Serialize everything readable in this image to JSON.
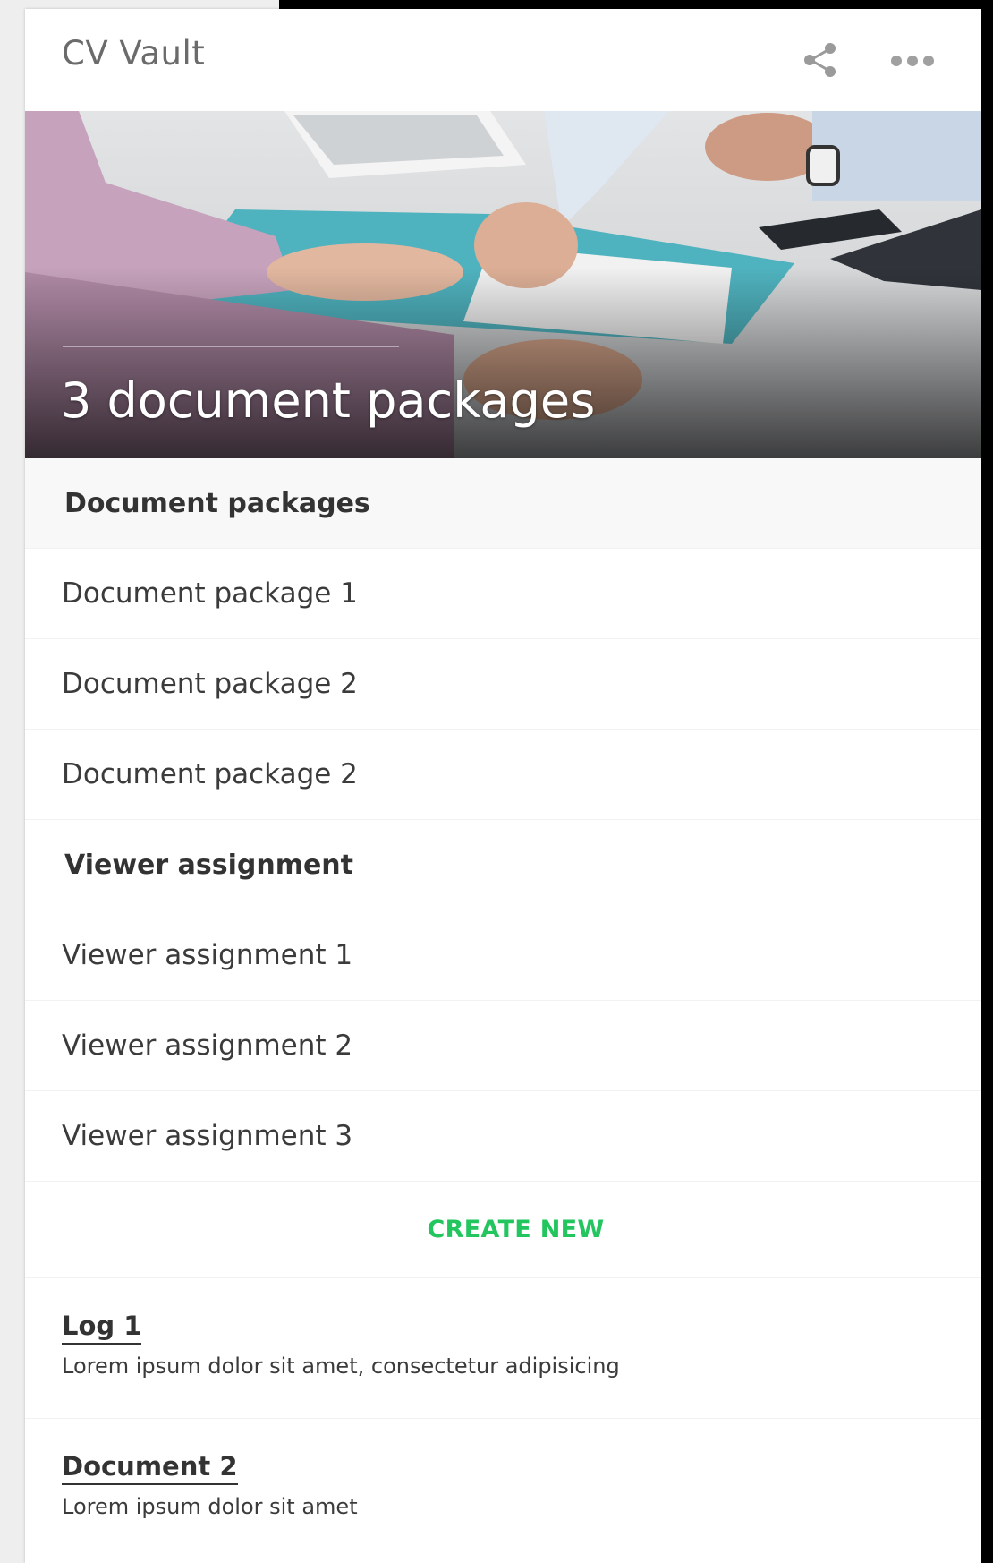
{
  "app": {
    "title": "CV Vault",
    "share_icon": "share-icon",
    "more_icon": "more-horizontal-icon"
  },
  "hero": {
    "title": "3 document packages"
  },
  "document_packages": {
    "header": "Document packages",
    "items": [
      "Document package 1",
      "Document package 2",
      "Document package 2"
    ]
  },
  "viewer_assignments": {
    "header": "Viewer assignment",
    "items": [
      "Viewer assignment 1",
      "Viewer assignment 2",
      "Viewer assignment 3"
    ]
  },
  "actions": {
    "create_new": "CREATE NEW"
  },
  "logs": [
    {
      "title": "Log 1",
      "description": "Lorem ipsum dolor sit amet, consectetur adipisicing"
    },
    {
      "title": "Document 2",
      "description": "Lorem ipsum dolor sit amet"
    }
  ],
  "colors": {
    "accent": "#22c55e",
    "text": "#3b3b3b",
    "app_title": "#6b6b6b"
  }
}
